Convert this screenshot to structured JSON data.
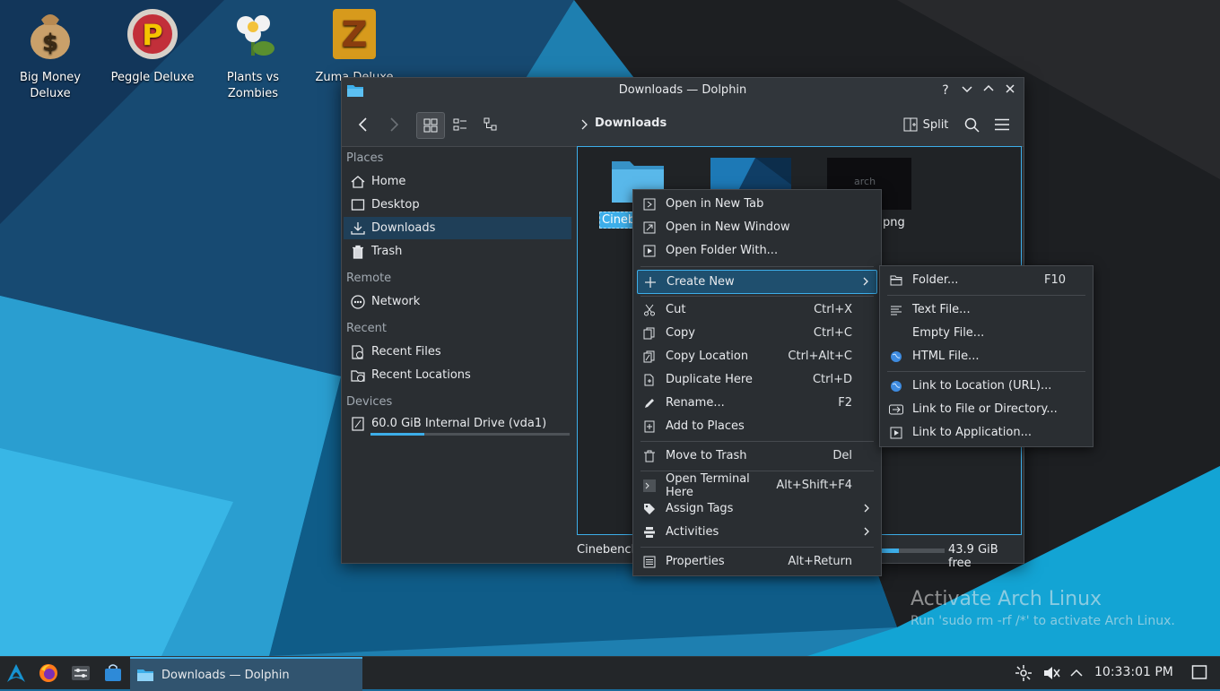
{
  "desktop": {
    "icons": [
      {
        "label_line1": "Big Money",
        "label_line2": "Deluxe"
      },
      {
        "label_line1": "Peggle Deluxe",
        "label_line2": ""
      },
      {
        "label_line1": "Plants vs",
        "label_line2": "Zombies"
      },
      {
        "label_line1": "Zuma Deluxe",
        "label_line2": ""
      }
    ],
    "watermark_title": "Activate Arch Linux",
    "watermark_text": "Run 'sudo rm -rf /*' to activate Arch Linux."
  },
  "window": {
    "title": "Downloads — Dolphin",
    "titlebar_buttons": {
      "help": "?"
    },
    "toolbar": {
      "split_label": "Split",
      "breadcrumb": "Downloads"
    },
    "sidebar": {
      "places_header": "Places",
      "places": [
        "Home",
        "Desktop",
        "Downloads",
        "Trash"
      ],
      "remote_header": "Remote",
      "remote": [
        "Network"
      ],
      "recent_header": "Recent",
      "recent": [
        "Recent Files",
        "Recent Locations"
      ],
      "devices_header": "Devices",
      "device": {
        "label": "60.0 GiB Internal Drive (vda1)",
        "usage_fraction": 0.27
      }
    },
    "files": [
      {
        "name_visible": "Cinebe",
        "type": "folder",
        "selected": true
      },
      {
        "name_visible": "",
        "type": "image"
      },
      {
        "name_visible": "png",
        "type": "image",
        "thumb_text": "arch"
      }
    ],
    "status": {
      "left_text": "Cinebench",
      "free_text": "43.9 GiB free",
      "usage_fraction": 0.27
    }
  },
  "context_menu": {
    "items": [
      {
        "label": "Open in New Tab",
        "shortcut": "",
        "icon": "new-tab-icon"
      },
      {
        "label": "Open in New Window",
        "shortcut": "",
        "icon": "new-window-icon"
      },
      {
        "label": "Open Folder With...",
        "shortcut": "",
        "icon": "open-with-icon"
      },
      {
        "label": "Create New",
        "shortcut": "",
        "icon": "plus-icon"
      },
      {
        "label": "Cut",
        "shortcut": "Ctrl+X",
        "icon": "scissors-icon"
      },
      {
        "label": "Copy",
        "shortcut": "Ctrl+C",
        "icon": "copy-icon"
      },
      {
        "label": "Copy Location",
        "shortcut": "Ctrl+Alt+C",
        "icon": "copy-location-icon"
      },
      {
        "label": "Duplicate Here",
        "shortcut": "Ctrl+D",
        "icon": "duplicate-icon"
      },
      {
        "label": "Rename...",
        "shortcut": "F2",
        "icon": "pencil-icon"
      },
      {
        "label": "Add to Places",
        "shortcut": "",
        "icon": "bookmark-icon"
      },
      {
        "label": "Move to Trash",
        "shortcut": "Del",
        "icon": "trash-icon"
      },
      {
        "label": "Open Terminal Here",
        "shortcut": "Alt+Shift+F4",
        "icon": "terminal-icon"
      },
      {
        "label": "Assign Tags",
        "shortcut": "",
        "icon": "tag-icon"
      },
      {
        "label": "Activities",
        "shortcut": "",
        "icon": "activities-icon"
      },
      {
        "label": "Properties",
        "shortcut": "Alt+Return",
        "icon": "properties-icon"
      }
    ]
  },
  "submenu": {
    "items": [
      {
        "label": "Folder...",
        "shortcut": "F10",
        "icon": "folder-icon"
      },
      {
        "label": "Text File...",
        "shortcut": "",
        "icon": "text-file-icon"
      },
      {
        "label": "Empty File...",
        "shortcut": "",
        "icon": ""
      },
      {
        "label": "HTML File...",
        "shortcut": "",
        "icon": "globe-icon"
      },
      {
        "label": "Link to Location (URL)...",
        "shortcut": "",
        "icon": "globe-icon"
      },
      {
        "label": "Link to File or Directory...",
        "shortcut": "",
        "icon": "link-icon"
      },
      {
        "label": "Link to Application...",
        "shortcut": "",
        "icon": "application-icon"
      }
    ]
  },
  "taskbar": {
    "task_label": "Downloads — Dolphin",
    "clock": "10:33:01 PM"
  },
  "colors": {
    "accent": "#3daee9",
    "window_bg": "#2a2e32",
    "selection": "#1f4f6e"
  }
}
